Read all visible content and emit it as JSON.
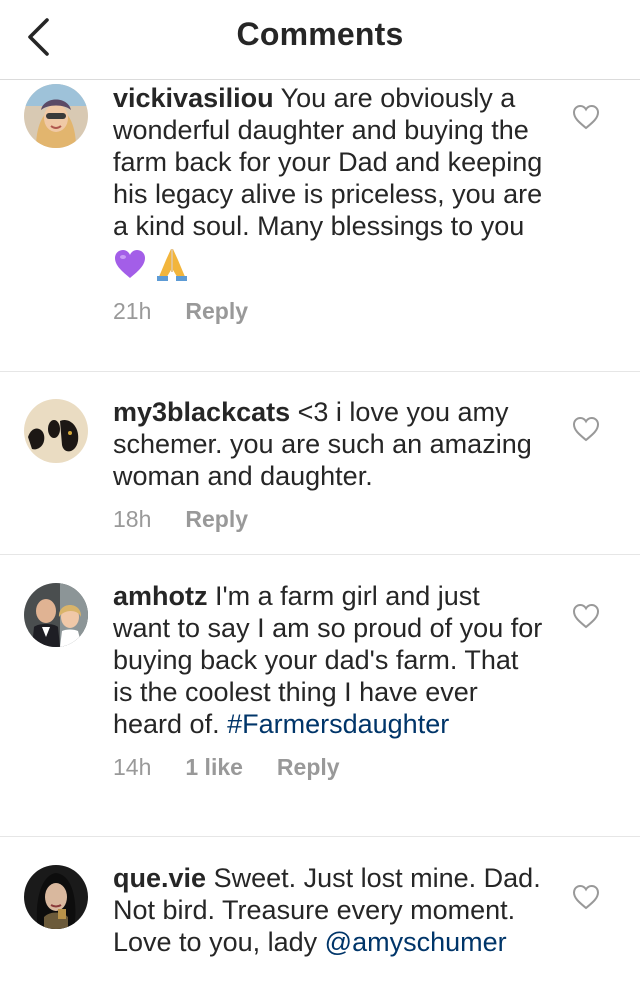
{
  "header": {
    "title": "Comments"
  },
  "comments": [
    {
      "username": "vickivasiliou",
      "text": "You are obviously a wonderful daughter and buying the farm back for your Dad and keeping his legacy alive is priceless, you are a kind soul. Many blessings to you",
      "emojis": [
        "💜",
        "🙏"
      ],
      "time": "21h",
      "reply": "Reply"
    },
    {
      "username": "my3blackcats",
      "text": "<3 i love you amy schemer.  you are such an amazing woman and daughter.",
      "time": "18h",
      "reply": "Reply"
    },
    {
      "username": "amhotz",
      "text": "I'm a farm girl and just want to say I am so proud of you for buying back your dad's farm. That is the coolest thing I have ever heard of.",
      "hashtag": "#Farmersdaughter",
      "time": "14h",
      "likes": "1 like",
      "reply": "Reply"
    },
    {
      "username": "que.vie",
      "text": "Sweet. Just lost mine. Dad. Not bird. Treasure every moment. Love to you, lady",
      "mention": "@amyschumer"
    }
  ]
}
